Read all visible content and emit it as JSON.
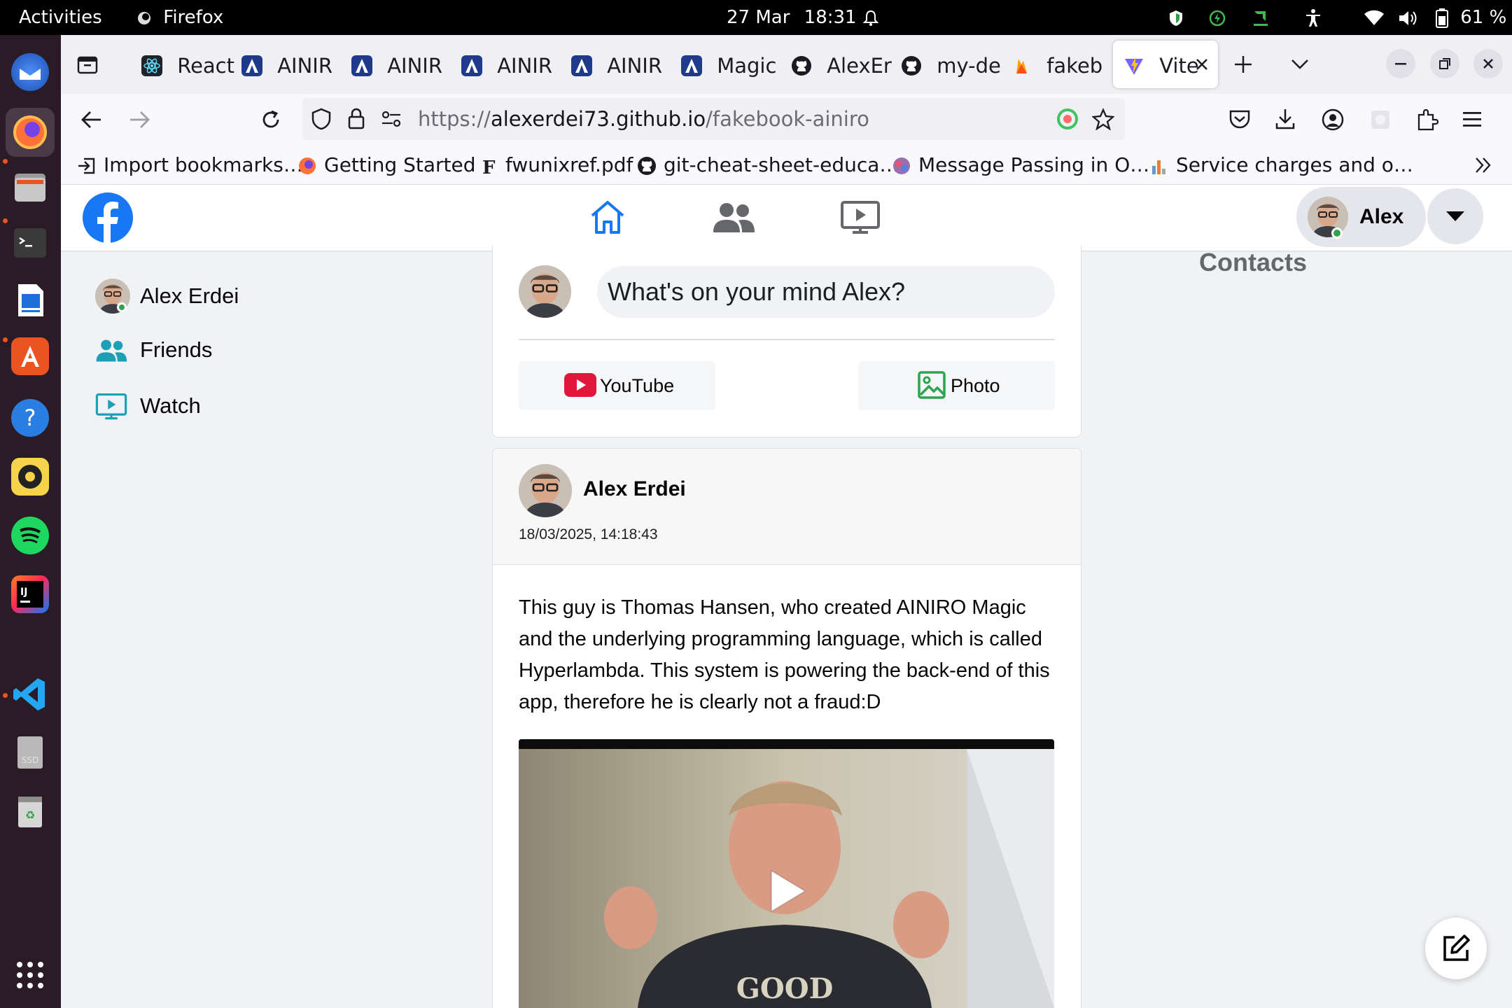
{
  "system_bar": {
    "activities": "Activities",
    "app_name": "Firefox",
    "date": "27 Mar",
    "time": "18:31",
    "battery": "61 %"
  },
  "dock": {
    "apps": [
      "thunderbird",
      "firefox",
      "files",
      "terminal",
      "writer",
      "app-center",
      "help",
      "rhythmbox",
      "spotify",
      "intellij",
      "vscode",
      "ssd-drive",
      "trash",
      "show-apps"
    ]
  },
  "browser": {
    "tabs": [
      {
        "label": "React",
        "icon": "react-icon"
      },
      {
        "label": "AINIR",
        "icon": "ainiro-icon"
      },
      {
        "label": "AINIR",
        "icon": "ainiro-icon"
      },
      {
        "label": "AINIR",
        "icon": "ainiro-icon"
      },
      {
        "label": "AINIR",
        "icon": "ainiro-icon"
      },
      {
        "label": "Magic",
        "icon": "ainiro-icon"
      },
      {
        "label": "AlexEr",
        "icon": "github-icon"
      },
      {
        "label": "my-de",
        "icon": "github-icon"
      },
      {
        "label": "fakeb",
        "icon": "firebase-icon"
      },
      {
        "label": "Vite",
        "icon": "vite-icon"
      }
    ],
    "url_prefix": "https://",
    "url_host": "alexerdei73.github.io",
    "url_path": "/fakebook-ainiro",
    "bookmarks": [
      {
        "label": "Import bookmarks…",
        "icon": "import-icon"
      },
      {
        "label": "Getting Started",
        "icon": "firefox-icon"
      },
      {
        "label": "fwunixref.pdf",
        "icon": "pdf-icon"
      },
      {
        "label": "git-cheat-sheet-educa…",
        "icon": "github-icon"
      },
      {
        "label": "Message Passing in O…",
        "icon": "site-icon"
      },
      {
        "label": "Service charges and o…",
        "icon": "chart-icon"
      }
    ]
  },
  "colors": {
    "facebook_blue": "#1877f2",
    "nav_green": "#31a24c",
    "sidebar_teal": "#1ba0b8",
    "youtube_red": "#ff0000",
    "photo_green": "#45bd62"
  },
  "fb": {
    "header": {
      "profile_name": "Alex"
    },
    "sidebar": {
      "items": [
        {
          "label": "Alex Erdei",
          "icon": "user-avatar"
        },
        {
          "label": "Friends",
          "icon": "friends-icon"
        },
        {
          "label": "Watch",
          "icon": "watch-icon"
        }
      ]
    },
    "composer": {
      "placeholder": "What's on your mind Alex?",
      "youtube_label": "YouTube",
      "photo_label": "Photo"
    },
    "post": {
      "author": "Alex Erdei",
      "timestamp": "18/03/2025, 14:18:43",
      "text": "This guy is Thomas Hansen, who created AINIRO Magic and the underlying programming language, which is called Hyperlambda. This system is powering the back-end of this app, therefore he is clearly not a fraud:D"
    },
    "contacts_title": "Contacts"
  }
}
